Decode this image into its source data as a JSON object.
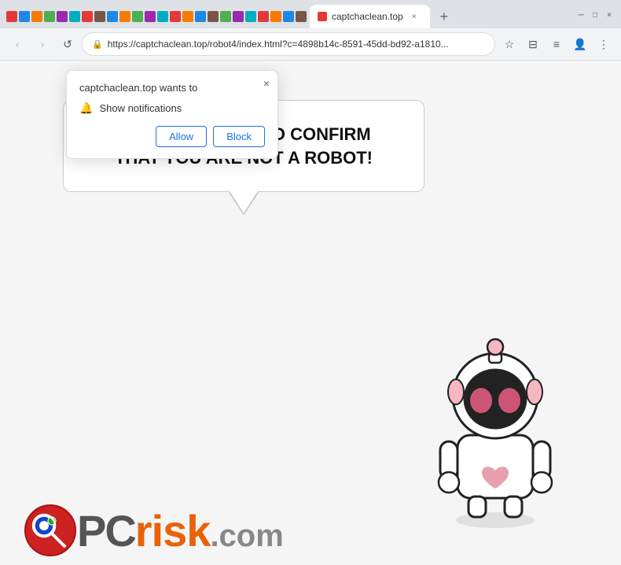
{
  "browser": {
    "url": "https://captchaclean.top/robot4/index.html?c=4898b14c-8591-45dd-bd92-a1810...",
    "tab_title": "captchaclean.top",
    "new_tab_label": "+",
    "nav": {
      "back_label": "‹",
      "forward_label": "›",
      "refresh_label": "↺"
    },
    "toolbar_icons": [
      "☆",
      "≡",
      "⊟",
      "👤",
      "⋮"
    ]
  },
  "notification_popup": {
    "title": "captchaclean.top wants to",
    "permission_text": "Show notifications",
    "allow_label": "Allow",
    "block_label": "Block",
    "close_label": "×"
  },
  "page": {
    "bubble_text": "CLICK «ALLOW» TO CONFIRM THAT YOU ARE NOT A ROBOT!",
    "background_color": "#f5f5f5"
  },
  "pcrisk": {
    "pc_text": "PC",
    "risk_text": "risk",
    "dotcom_text": ".com"
  }
}
